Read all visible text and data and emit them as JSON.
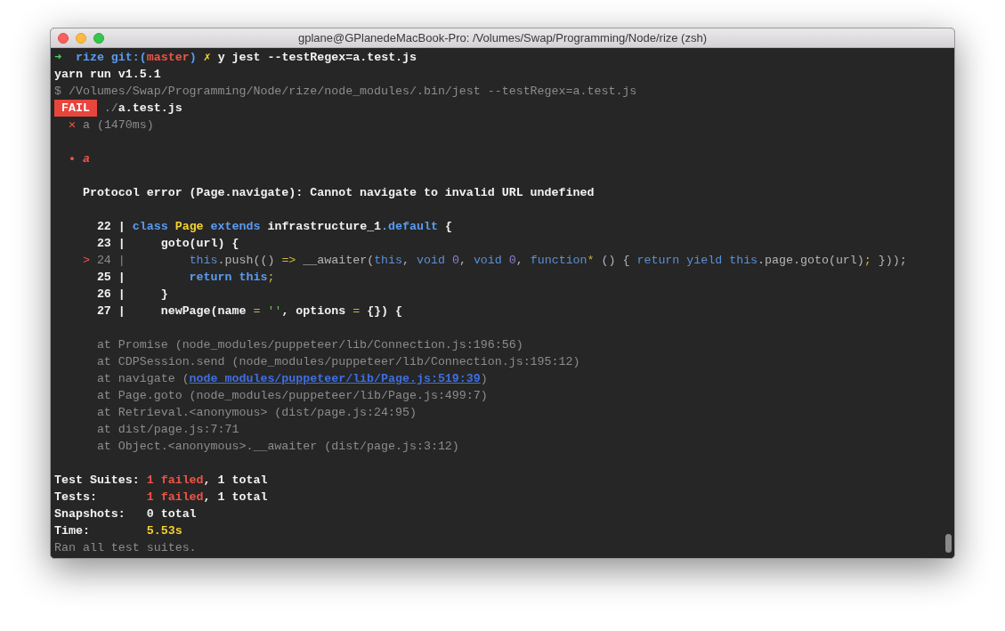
{
  "window": {
    "title": "gplane@GPlanedeMacBook-Pro: /Volumes/Swap/Programming/Node/rize (zsh)"
  },
  "terminal": {
    "lines": [
      {
        "kind": "text",
        "segments": [
          {
            "text": "➜",
            "kind": "arrow"
          },
          {
            "text": "  rize git:(",
            "kind": "blue"
          },
          {
            "text": "master",
            "kind": "red"
          },
          {
            "text": ")",
            "kind": "blue"
          },
          {
            "text": " ✗",
            "kind": "yellow"
          },
          {
            "text": " y jest --testRegex=a.test.js",
            "kind": "text"
          }
        ]
      },
      {
        "kind": "text",
        "segments": [
          {
            "text": "yarn run v1.5.1",
            "kind": "text"
          }
        ]
      },
      {
        "kind": "text",
        "segments": [
          {
            "text": "$ /Volumes/Swap/Programming/Node/rize/node_modules/.bin/jest --testRegex=a.test.js",
            "kind": "dim"
          }
        ]
      },
      {
        "kind": "text",
        "segments": [
          {
            "text": " FAIL ",
            "kind": "fail"
          },
          {
            "text": " ./",
            "kind": "dim"
          },
          {
            "text": "a.test.js",
            "kind": "text"
          }
        ]
      },
      {
        "kind": "text",
        "segments": [
          {
            "text": "  ✕",
            "kind": "red"
          },
          {
            "text": " a (1470ms)",
            "kind": "dim"
          }
        ]
      },
      {
        "kind": "blank"
      },
      {
        "kind": "text",
        "segments": [
          {
            "text": "  •",
            "kind": "red"
          },
          {
            "text": " a",
            "kind": "error-title"
          }
        ]
      },
      {
        "kind": "blank"
      },
      {
        "kind": "text",
        "segments": [
          {
            "text": "    Protocol error (Page.navigate): Cannot navigate to invalid URL undefined",
            "kind": "text"
          }
        ]
      },
      {
        "kind": "blank"
      },
      {
        "kind": "text",
        "segments": [
          {
            "text": "      22 | ",
            "kind": "text"
          },
          {
            "text": "class",
            "kind": "keyword"
          },
          {
            "text": " Page",
            "kind": "yellow"
          },
          {
            "text": " extends",
            "kind": "keyword"
          },
          {
            "text": " infrastructure_1",
            "kind": "text"
          },
          {
            "text": ".default",
            "kind": "keyword"
          },
          {
            "text": " {",
            "kind": "text"
          }
        ]
      },
      {
        "kind": "text",
        "segments": [
          {
            "text": "      23 |     goto(url) {",
            "kind": "text"
          }
        ]
      },
      {
        "kind": "text",
        "segments": [
          {
            "text": "    >",
            "kind": "marker"
          },
          {
            "text": " 24 |",
            "kind": "dim"
          },
          {
            "text": "         this",
            "kind": "code-keyword"
          },
          {
            "text": ".push(() ",
            "kind": "code"
          },
          {
            "text": "=>",
            "kind": "punct"
          },
          {
            "text": " __awaiter(",
            "kind": "code"
          },
          {
            "text": "this",
            "kind": "code-keyword"
          },
          {
            "text": ", ",
            "kind": "code"
          },
          {
            "text": "void",
            "kind": "code-keyword"
          },
          {
            "text": " 0",
            "kind": "number"
          },
          {
            "text": ", ",
            "kind": "code"
          },
          {
            "text": "void",
            "kind": "code-keyword"
          },
          {
            "text": " 0",
            "kind": "number"
          },
          {
            "text": ", ",
            "kind": "code"
          },
          {
            "text": "function",
            "kind": "code-keyword"
          },
          {
            "text": "*",
            "kind": "punct"
          },
          {
            "text": " () { ",
            "kind": "code"
          },
          {
            "text": "return yield this",
            "kind": "code-keyword"
          },
          {
            "text": ".page.goto(url)",
            "kind": "code"
          },
          {
            "text": ";",
            "kind": "punct"
          },
          {
            "text": " }));",
            "kind": "code"
          }
        ]
      },
      {
        "kind": "text",
        "segments": [
          {
            "text": "      25 | ",
            "kind": "text"
          },
          {
            "text": "        return this",
            "kind": "keyword"
          },
          {
            "text": ";",
            "kind": "punct"
          }
        ]
      },
      {
        "kind": "text",
        "segments": [
          {
            "text": "      26 |     }",
            "kind": "text"
          }
        ]
      },
      {
        "kind": "text",
        "segments": [
          {
            "text": "      27 |     newPage(name ",
            "kind": "text"
          },
          {
            "text": "=",
            "kind": "punct"
          },
          {
            "text": " ''",
            "kind": "string"
          },
          {
            "text": ", options ",
            "kind": "text"
          },
          {
            "text": "=",
            "kind": "punct"
          },
          {
            "text": " {}) {",
            "kind": "text"
          }
        ]
      },
      {
        "kind": "blank"
      },
      {
        "kind": "text",
        "segments": [
          {
            "text": "      at Promise (node_modules/puppeteer/lib/Connection.js:196:56)",
            "kind": "dim"
          }
        ]
      },
      {
        "kind": "text",
        "segments": [
          {
            "text": "      at CDPSession.send (node_modules/puppeteer/lib/Connection.js:195:12)",
            "kind": "dim"
          }
        ]
      },
      {
        "kind": "text",
        "segments": [
          {
            "text": "      at navigate (",
            "kind": "dim"
          },
          {
            "text": "node_modules/puppeteer/lib/Page.js:519:39",
            "kind": "link"
          },
          {
            "text": ")",
            "kind": "dim"
          }
        ]
      },
      {
        "kind": "text",
        "segments": [
          {
            "text": "      at Page.goto (node_modules/puppeteer/lib/Page.js:499:7)",
            "kind": "dim"
          }
        ]
      },
      {
        "kind": "text",
        "segments": [
          {
            "text": "      at Retrieval.<anonymous> (dist/page.js:24:95)",
            "kind": "dim"
          }
        ]
      },
      {
        "kind": "text",
        "segments": [
          {
            "text": "      at dist/page.js:7:71",
            "kind": "dim"
          }
        ]
      },
      {
        "kind": "text",
        "segments": [
          {
            "text": "      at Object.<anonymous>.__awaiter (dist/page.js:3:12)",
            "kind": "dim"
          }
        ]
      },
      {
        "kind": "blank"
      },
      {
        "kind": "text",
        "segments": [
          {
            "text": "Test Suites: ",
            "kind": "text"
          },
          {
            "text": "1 failed",
            "kind": "red"
          },
          {
            "text": ", 1 total",
            "kind": "text"
          }
        ]
      },
      {
        "kind": "text",
        "segments": [
          {
            "text": "Tests:       ",
            "kind": "text"
          },
          {
            "text": "1 failed",
            "kind": "red"
          },
          {
            "text": ", 1 total",
            "kind": "text"
          }
        ]
      },
      {
        "kind": "text",
        "segments": [
          {
            "text": "Snapshots:   0 total",
            "kind": "text"
          }
        ]
      },
      {
        "kind": "text",
        "segments": [
          {
            "text": "Time:        ",
            "kind": "text"
          },
          {
            "text": "5.53s",
            "kind": "yellow"
          }
        ]
      },
      {
        "kind": "text",
        "segments": [
          {
            "text": "Ran all test suites.",
            "kind": "dim"
          }
        ]
      }
    ]
  }
}
